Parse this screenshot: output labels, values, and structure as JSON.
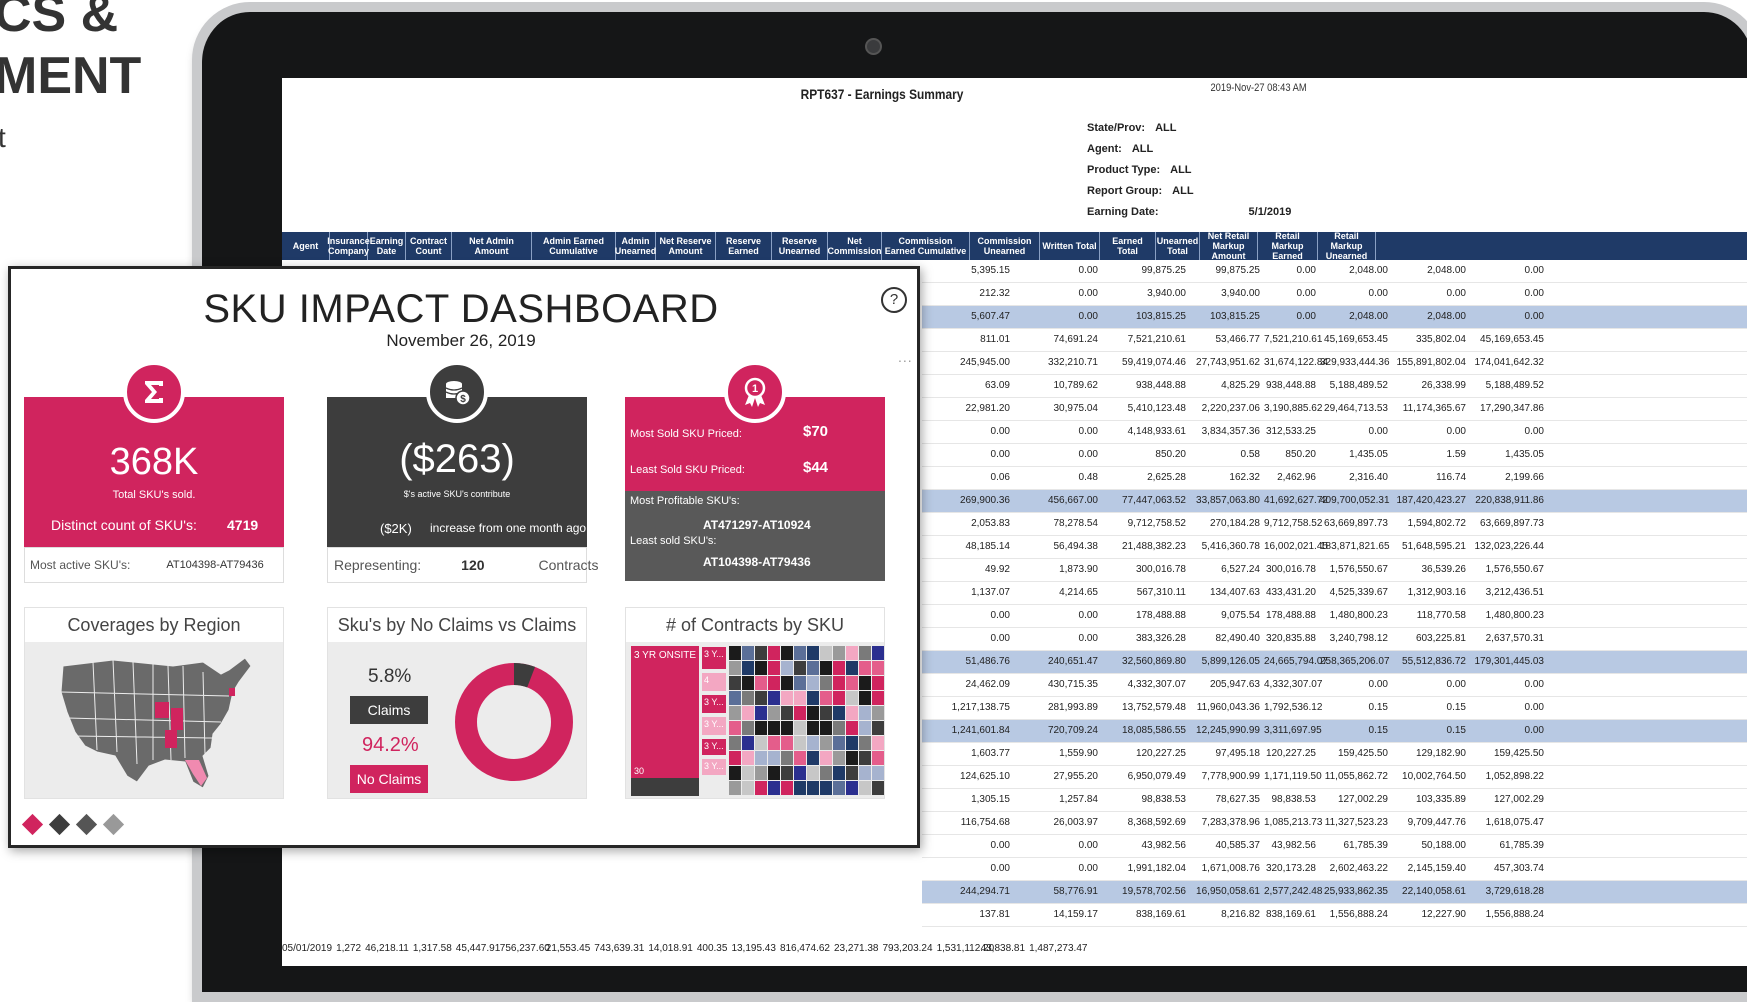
{
  "hero": {
    "title_line1": "CS &",
    "title_line2": "MENT",
    "subtitle": "t"
  },
  "report": {
    "title": "RPT637 - Earnings Summary",
    "timestamp": "2019-Nov-27 08:43 AM",
    "params": [
      {
        "label": "State/Prov:",
        "value": "ALL"
      },
      {
        "label": "Agent:",
        "value": "ALL"
      },
      {
        "label": "Product Type:",
        "value": "ALL"
      },
      {
        "label": "Report Group:",
        "value": "ALL"
      },
      {
        "label": "Earning Date:",
        "value": "5/1/2019"
      }
    ],
    "columns": [
      "Agent",
      "Insurance Company",
      "Earning Date",
      "Contract Count",
      "Net Admin Amount",
      "Admin Earned Cumulative",
      "Admin Unearned",
      "Net Reserve Amount",
      "Reserve Earned",
      "Reserve Unearned",
      "Net Commission",
      "Commission Earned Cumulative",
      "Commission Unearned",
      "Written Total",
      "Earned Total",
      "Unearned Total",
      "Net Retail Markup Amount",
      "Retail Markup Earned",
      "Retail Markup Unearned"
    ],
    "rows": [
      [
        "5,395.15",
        "0.00",
        "99,875.25",
        "99,875.25",
        "0.00",
        "2,048.00",
        "2,048.00",
        "0.00"
      ],
      [
        "212.32",
        "0.00",
        "3,940.00",
        "3,940.00",
        "0.00",
        "0.00",
        "0.00",
        "0.00"
      ],
      [
        "5,607.47",
        "0.00",
        "103,815.25",
        "103,815.25",
        "0.00",
        "2,048.00",
        "2,048.00",
        "0.00"
      ],
      [
        "811.01",
        "74,691.24",
        "7,521,210.61",
        "53,466.77",
        "7,521,210.61",
        "45,169,653.45",
        "335,802.04",
        "45,169,653.45"
      ],
      [
        "245,945.00",
        "332,210.71",
        "59,419,074.46",
        "27,743,951.62",
        "31,674,122.84",
        "329,933,444.36",
        "155,891,802.04",
        "174,041,642.32"
      ],
      [
        "63.09",
        "10,789.62",
        "938,448.88",
        "4,825.29",
        "938,448.88",
        "5,188,489.52",
        "26,338.99",
        "5,188,489.52"
      ],
      [
        "22,981.20",
        "30,975.04",
        "5,410,123.48",
        "2,220,237.06",
        "3,190,885.62",
        "29,464,713.53",
        "11,174,365.67",
        "17,290,347.86"
      ],
      [
        "0.00",
        "0.00",
        "4,148,933.61",
        "3,834,357.36",
        "312,533.25",
        "0.00",
        "0.00",
        "0.00"
      ],
      [
        "0.00",
        "0.00",
        "850.20",
        "0.58",
        "850.20",
        "1,435.05",
        "1.59",
        "1,435.05"
      ],
      [
        "0.06",
        "0.48",
        "2,625.28",
        "162.32",
        "2,462.96",
        "2,316.40",
        "116.74",
        "2,199.66"
      ],
      [
        "269,900.36",
        "456,667.00",
        "77,447,063.52",
        "33,857,063.80",
        "41,692,627.72",
        "409,700,052.31",
        "187,420,423.27",
        "220,838,911.86"
      ],
      [
        "2,053.83",
        "78,278.54",
        "9,712,758.52",
        "270,184.28",
        "9,712,758.52",
        "63,669,897.73",
        "1,594,802.72",
        "63,669,897.73"
      ],
      [
        "48,185.14",
        "56,494.38",
        "21,488,382.23",
        "5,416,360.78",
        "16,002,021.45",
        "183,871,821.65",
        "51,648,595.21",
        "132,023,226.44"
      ],
      [
        "49.92",
        "1,873.90",
        "300,016.78",
        "6,527.24",
        "300,016.78",
        "1,576,550.67",
        "36,539.26",
        "1,576,550.67"
      ],
      [
        "1,137.07",
        "4,214.65",
        "567,310.11",
        "134,407.63",
        "433,431.20",
        "4,525,339.67",
        "1,312,903.16",
        "3,212,436.51"
      ],
      [
        "0.00",
        "0.00",
        "178,488.88",
        "9,075.54",
        "178,488.88",
        "1,480,800.23",
        "118,770.58",
        "1,480,800.23"
      ],
      [
        "0.00",
        "0.00",
        "383,326.28",
        "82,490.40",
        "320,835.88",
        "3,240,798.12",
        "603,225.81",
        "2,637,570.31"
      ],
      [
        "51,486.76",
        "240,651.47",
        "32,560,869.80",
        "5,899,126.05",
        "24,665,794.07",
        "258,365,206.07",
        "55,512,836.72",
        "179,301,445.03"
      ],
      [
        "24,462.09",
        "430,715.35",
        "4,332,307.07",
        "205,947.63",
        "4,332,307.07",
        "0.00",
        "0.00",
        "0.00"
      ],
      [
        "1,217,138.75",
        "281,993.89",
        "13,752,579.48",
        "11,960,043.36",
        "1,792,536.12",
        "0.15",
        "0.15",
        "0.00"
      ],
      [
        "1,241,601.84",
        "720,709.24",
        "18,085,586.55",
        "12,245,990.99",
        "3,311,697.95",
        "0.15",
        "0.15",
        "0.00"
      ],
      [
        "1,603.77",
        "1,559.90",
        "120,227.25",
        "97,495.18",
        "120,227.25",
        "159,425.50",
        "129,182.90",
        "159,425.50"
      ],
      [
        "124,625.10",
        "27,955.20",
        "6,950,079.49",
        "7,778,900.99",
        "1,171,119.50",
        "11,055,862.72",
        "10,002,764.50",
        "1,052,898.22"
      ],
      [
        "1,305.15",
        "1,257.84",
        "98,838.53",
        "78,627.35",
        "98,838.53",
        "127,002.29",
        "103,335.89",
        "127,002.29"
      ],
      [
        "116,754.68",
        "26,003.97",
        "8,368,592.69",
        "7,283,378.96",
        "1,085,213.73",
        "11,327,523.23",
        "9,709,447.76",
        "1,618,075.47"
      ],
      [
        "0.00",
        "0.00",
        "43,982.56",
        "40,585.37",
        "43,982.56",
        "61,785.39",
        "50,188.00",
        "61,785.39"
      ],
      [
        "0.00",
        "0.00",
        "1,991,182.04",
        "1,671,008.76",
        "320,173.28",
        "2,602,463.22",
        "2,145,159.40",
        "457,303.74"
      ],
      [
        "244,294.71",
        "58,776.91",
        "19,578,702.56",
        "16,950,058.61",
        "2,577,242.48",
        "25,933,862.35",
        "22,140,058.61",
        "3,729,618.28"
      ],
      [
        "137.81",
        "14,159.17",
        "838,169.61",
        "8,216.82",
        "838,169.61",
        "1,556,888.24",
        "12,227.90",
        "1,556,888.24"
      ]
    ],
    "alt_rows": [
      2,
      10,
      17,
      20,
      27
    ],
    "bottom_row": [
      "05/01/2019",
      "1,272",
      "46,218.11",
      "1,317.58",
      "45,447.91",
      "756,237.60",
      "21,553.45",
      "743,639.31",
      "14,018.91",
      "400.35",
      "13,195.43",
      "816,474.62",
      "23,271.38",
      "793,203.24",
      "1,531,112.20",
      "43,838.81",
      "1,487,273.47"
    ]
  },
  "dashboard": {
    "title": "SKU IMPACT DASHBOARD",
    "date": "November 26, 2019",
    "help": "?",
    "more": "...",
    "card1": {
      "value": "368K",
      "caption": "Total SKU's sold.",
      "distinct_label": "Distinct count of SKU's:",
      "distinct_value": "4719",
      "active_label": "Most active SKU's:",
      "active_value": "AT104398-AT79436"
    },
    "card2": {
      "value": "($263)",
      "caption": "$'s active SKU's contribute",
      "change_value": "($2K)",
      "change_label": "increase from one month ago",
      "rep_label": "Representing:",
      "rep_value": "120",
      "rep_unit": "Contracts"
    },
    "card3": {
      "most_sold_label": "Most Sold SKU Priced:",
      "most_sold_value": "$70",
      "least_sold_label": "Least Sold SKU Priced:",
      "least_sold_value": "$44",
      "profitable_label": "Most Profitable SKU's:",
      "profitable_value": "AT471297-AT10924",
      "least_label": "Least sold SKU's:",
      "least_value": "AT104398-AT79436"
    },
    "panel1": {
      "title": "Coverages by Region"
    },
    "panel2": {
      "title": "Sku's by No Claims vs Claims",
      "claims_pct": "5.8%",
      "claims_label": "Claims",
      "no_claims_pct": "94.2%",
      "no_claims_label": "No Claims"
    },
    "panel3": {
      "title": "# of Contracts by SKU",
      "main_label": "3 YR ONSITE",
      "main_value": "30",
      "cell_labels": [
        "3 Y...",
        "4",
        "3 Y...",
        "3 Y...",
        "3 Y...",
        "3 Y..."
      ]
    },
    "colors": {
      "brand": "#d0245e",
      "dark": "#3d3d3d",
      "navy": "#1f3a67"
    },
    "pager_count": 4
  }
}
